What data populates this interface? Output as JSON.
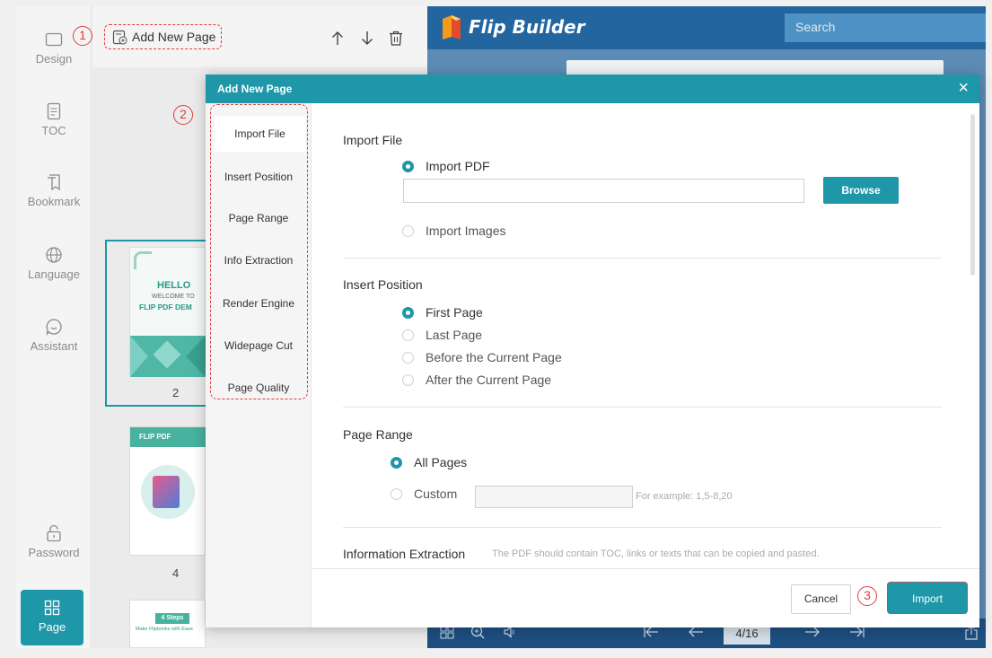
{
  "sidebar": {
    "items": [
      {
        "label": "Design",
        "icon": "square-icon"
      },
      {
        "label": "TOC",
        "icon": "document-icon"
      },
      {
        "label": "Bookmark",
        "icon": "bookmark-icon"
      },
      {
        "label": "Language",
        "icon": "globe-icon"
      },
      {
        "label": "Assistant",
        "icon": "chat-icon"
      },
      {
        "label": "Password",
        "icon": "lock-icon"
      },
      {
        "label": "Page",
        "icon": "grid-icon"
      }
    ]
  },
  "page_panel": {
    "add_new_page": "Add New Page",
    "thumbs": [
      {
        "page": "2",
        "hello": "HELLO",
        "welcome": "WELCOME TO",
        "demo": "FLIP PDF DEM"
      },
      {
        "page": "4",
        "title": "FLIP PDF"
      },
      {
        "title": "4 Steps",
        "subtitle": "Make Flipbooks with Ease"
      }
    ]
  },
  "viewer": {
    "title": "Flip Builder",
    "search_placeholder": "Search",
    "page_indicator": "4/16"
  },
  "steps": {
    "one": "1",
    "two": "2",
    "three": "3"
  },
  "dialog": {
    "title": "Add New Page",
    "close": "×",
    "nav": [
      "Import File",
      "Insert Position",
      "Page Range",
      "Info Extraction",
      "Render Engine",
      "Widepage Cut",
      "Page Quality"
    ],
    "import_file": {
      "title": "Import File",
      "pdf_option": "Import PDF",
      "browse": "Browse",
      "images_option": "Import Images"
    },
    "insert_position": {
      "title": "Insert Position",
      "options": [
        "First Page",
        "Last Page",
        "Before the Current Page",
        "After the Current Page"
      ]
    },
    "page_range": {
      "title": "Page Range",
      "all": "All Pages",
      "custom": "Custom",
      "example": "For example: 1,5-8,20"
    },
    "info_extraction": {
      "title": "Information Extraction",
      "note": "The PDF should contain TOC, links or texts that can be copied and pasted."
    },
    "cancel": "Cancel",
    "import": "Import"
  },
  "colors": {
    "accent": "#1e97a8",
    "annotation": "#e03c3c",
    "viewer_bar": "#22659f"
  }
}
